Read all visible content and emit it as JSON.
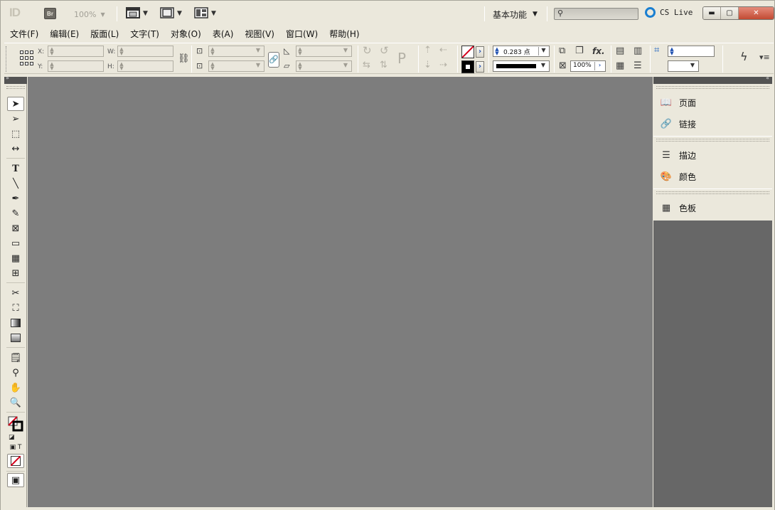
{
  "app": {
    "logo": "ID",
    "bridge_label": "Br",
    "zoom": "100%",
    "workspace": "基本功能",
    "search_placeholder": "",
    "cs_live": "CS Live"
  },
  "menu": [
    "文件(F)",
    "编辑(E)",
    "版面(L)",
    "文字(T)",
    "对象(O)",
    "表(A)",
    "视图(V)",
    "窗口(W)",
    "帮助(H)"
  ],
  "control": {
    "x_label": "X:",
    "y_label": "Y:",
    "w_label": "W:",
    "h_label": "H:",
    "x_value": "",
    "y_value": "",
    "w_value": "",
    "h_value": "",
    "stroke_weight": "0.283 点",
    "opacity": "100%",
    "fill_color": "#ffffff",
    "stroke_color": "#000000"
  },
  "tools": [
    "selection-tool",
    "direct-selection-tool",
    "page-tool",
    "gap-tool",
    "type-tool",
    "line-tool",
    "pen-tool",
    "pencil-tool",
    "rectangle-frame-tool",
    "rectangle-tool",
    "table-tool-1",
    "table-tool-2",
    "scissors-tool",
    "free-transform-tool",
    "gradient-swatch-tool",
    "gradient-feather-tool",
    "note-tool",
    "eyedropper-tool",
    "hand-tool",
    "zoom-tool"
  ],
  "panels": {
    "group1": [
      "页面",
      "链接"
    ],
    "group2": [
      "描边",
      "颜色"
    ],
    "group3": [
      "色板"
    ]
  }
}
